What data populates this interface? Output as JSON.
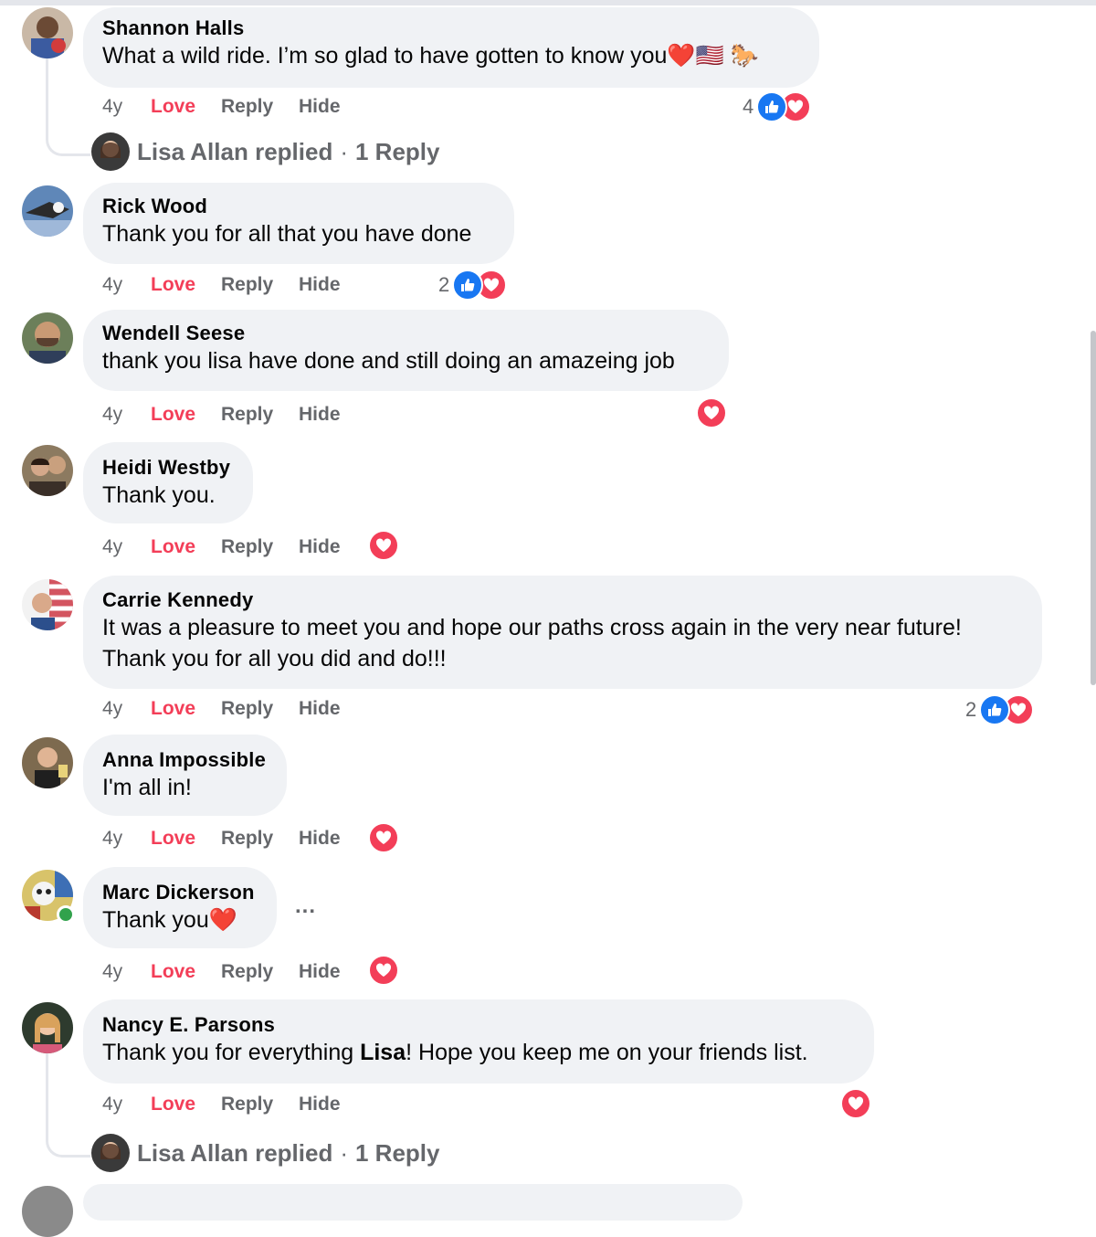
{
  "actions": {
    "time": "4y",
    "love": "Love",
    "reply": "Reply",
    "hide": "Hide"
  },
  "comments": [
    {
      "author": "Shannon Halls",
      "text": "What a wild ride. I’m so glad to have gotten to know you",
      "emoji": "❤️🇺🇸 🐎",
      "reaction_count": "4",
      "reactions": [
        "like-icon",
        "love-icon"
      ]
    },
    {
      "author": "Rick Wood",
      "text": "Thank you for all that you have done",
      "reaction_count": "2",
      "reactions": [
        "like-icon",
        "love-icon"
      ]
    },
    {
      "author": "Wendell Seese",
      "text": "thank you lisa have done and still doing an amazeing job",
      "reactions": [
        "love-icon"
      ]
    },
    {
      "author": "Heidi Westby",
      "text": "Thank you.",
      "reactions": [
        "love-icon"
      ]
    },
    {
      "author": "Carrie Kennedy",
      "text_line1": "It was a pleasure to meet you and hope our paths cross again in the very near future!",
      "text_line2": "Thank you for all you did and do!!!",
      "reaction_count": "2",
      "reactions": [
        "like-icon",
        "love-icon"
      ]
    },
    {
      "author": "Anna Impossible",
      "text": "I'm all in!",
      "reactions": [
        "love-icon"
      ]
    },
    {
      "author": "Marc Dickerson",
      "text": "Thank you",
      "emoji": "❤️",
      "more": "...",
      "reactions": [
        "love-icon"
      ]
    },
    {
      "author": "Nancy E. Parsons",
      "text_before": "Thank you for everything ",
      "text_bold": "Lisa",
      "text_after": "! Hope you keep me on your friends list.",
      "reactions": [
        "love-icon"
      ]
    }
  ],
  "replies": [
    {
      "name": "Lisa Allan replied",
      "sep": "·",
      "count": "1 Reply"
    },
    {
      "name": "Lisa Allan replied",
      "sep": "·",
      "count": "1 Reply"
    }
  ],
  "colors": {
    "bubble": "#f0f2f5",
    "love": "#f33e58",
    "like": "#1877f2",
    "muted": "#65676b"
  }
}
